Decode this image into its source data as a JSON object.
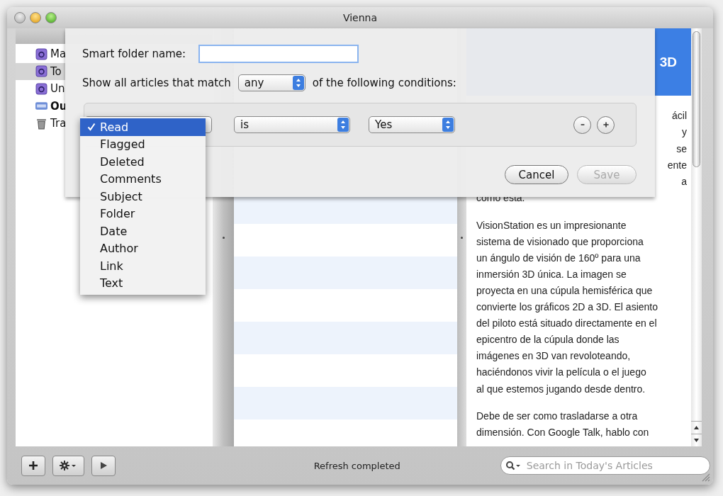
{
  "window": {
    "title": "Vienna"
  },
  "sidebar": {
    "items": [
      {
        "label": "Ma",
        "kind": "smart",
        "selected": false,
        "unread": false
      },
      {
        "label": "To",
        "kind": "smart",
        "selected": true,
        "unread": false
      },
      {
        "label": "Un",
        "kind": "smart",
        "selected": false,
        "unread": false
      },
      {
        "label": "Ou",
        "kind": "rss",
        "selected": false,
        "unread": true
      },
      {
        "label": "Tra",
        "kind": "trash",
        "selected": false,
        "unread": false
      }
    ]
  },
  "article": {
    "header_title": "3D",
    "fragment_lines": [
      "ácil",
      "y",
      "se",
      "ente",
      "a"
    ],
    "paragraphs": [
      {
        "lines": [
          "como esta."
        ]
      },
      {
        "lines": [
          "VisionStation es un impresionante",
          "sistema de visionado que proporciona",
          "un ángulo de visión de 160º para una",
          "inmersión 3D única. La imagen se",
          "proyecta en una cúpula hemisférica que",
          "convierte los gráficos 2D a 3D. El asiento",
          "del piloto está situado directamente en el",
          "epicentro de la cúpula donde las",
          "imágenes en 3D van revoloteando,",
          "haciéndonos vivir la película o el juego",
          "al que estemos jugando desde dentro."
        ]
      },
      {
        "lines": [
          "Debe de ser como trasladarse a otra",
          "dimensión. Con Google Talk, hablo con"
        ]
      }
    ]
  },
  "status_bar": {
    "text": "Refresh completed"
  },
  "search": {
    "placeholder": "Search in Today's Articles"
  },
  "sheet": {
    "name_label": "Smart folder name:",
    "match_prefix": "Show all articles that match",
    "match_value": "any",
    "match_suffix": "of the following conditions:",
    "condition": {
      "operator": "is",
      "value": "Yes"
    },
    "buttons": [
      {
        "label": "Cancel",
        "disabled": false
      },
      {
        "label": "Save",
        "disabled": true
      }
    ]
  },
  "field_menu": {
    "items": [
      {
        "label": "Read",
        "selected": true
      },
      {
        "label": "Flagged",
        "selected": false
      },
      {
        "label": "Deleted",
        "selected": false
      },
      {
        "label": "Comments",
        "selected": false
      },
      {
        "label": "Subject",
        "selected": false
      },
      {
        "label": "Folder",
        "selected": false
      },
      {
        "label": "Date",
        "selected": false
      },
      {
        "label": "Author",
        "selected": false
      },
      {
        "label": "Link",
        "selected": false
      },
      {
        "label": "Text",
        "selected": false
      }
    ]
  }
}
